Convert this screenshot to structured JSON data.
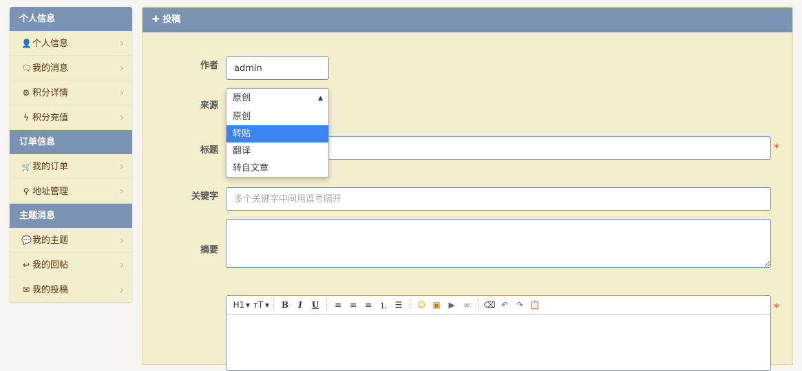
{
  "sidebar": {
    "groups": [
      {
        "title": "个人信息",
        "items": [
          {
            "label": "个人信息",
            "icon": "user-icon"
          },
          {
            "label": "我的消息",
            "icon": "comments-icon"
          },
          {
            "label": "积分详情",
            "icon": "gear-icon"
          },
          {
            "label": "积分充值",
            "icon": "bolt-icon"
          }
        ]
      },
      {
        "title": "订单信息",
        "items": [
          {
            "label": "我的订单",
            "icon": "cart-icon"
          },
          {
            "label": "地址管理",
            "icon": "map-marker-icon"
          }
        ]
      },
      {
        "title": "主题消息",
        "items": [
          {
            "label": "我的主题",
            "icon": "comment-icon"
          },
          {
            "label": "我的回帖",
            "icon": "reply-icon"
          },
          {
            "label": "我的投稿",
            "icon": "envelope-icon"
          }
        ]
      }
    ]
  },
  "main": {
    "title": "投稿",
    "form": {
      "author_label": "作者",
      "author_value": "admin",
      "source_label": "来源",
      "source_value": "原创",
      "source_options": [
        "原创",
        "转贴",
        "翻译",
        "转自文章"
      ],
      "source_highlighted": "转贴",
      "title_label": "标题",
      "title_value": "",
      "keywords_label": "关键字",
      "keywords_placeholder": "多个关键字中间用逗号隔开",
      "abstract_label": "摘要",
      "required_mark": "*"
    },
    "editor_toolbar": [
      "H1",
      "тT",
      "B",
      "I",
      "U"
    ]
  }
}
